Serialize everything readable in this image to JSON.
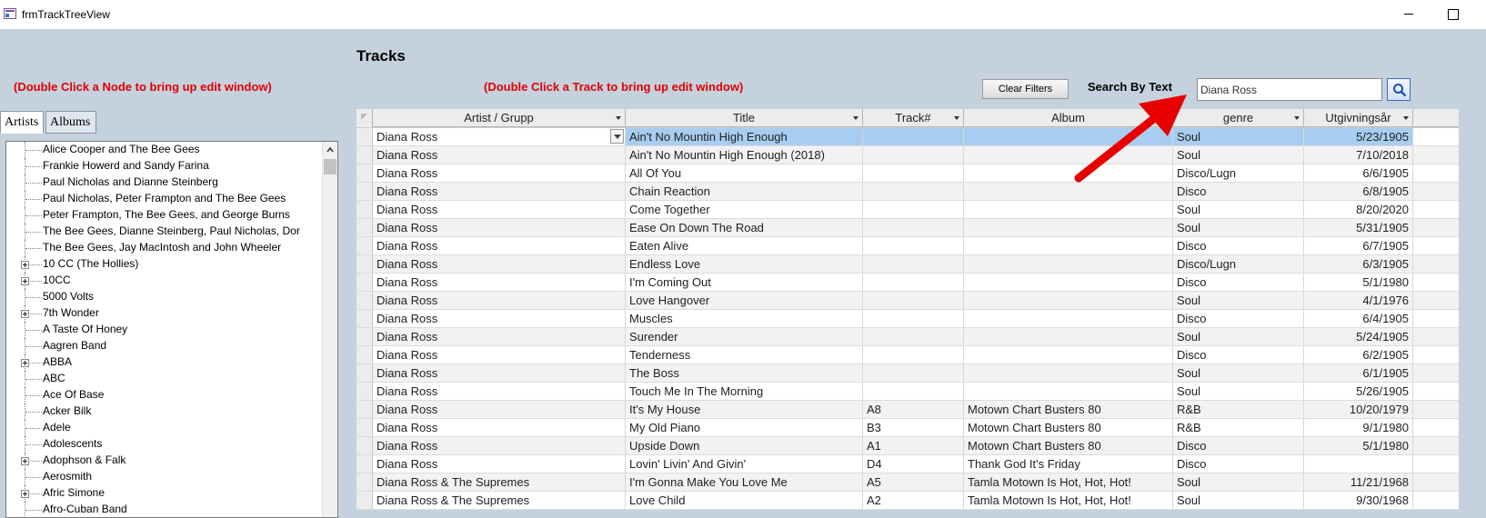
{
  "window": {
    "title": "frmTrackTreeView"
  },
  "form": {
    "heading": "Tracks",
    "tree_hint": "(Double Click a Node to bring up edit window)",
    "grid_hint": "(Double Click a Track to bring up edit window)",
    "clear_filters_label": "Clear Filters",
    "search_label": "Search By Text",
    "search_value": "Diana Ross"
  },
  "tabs": [
    {
      "label": "Artists"
    },
    {
      "label": "Albums"
    }
  ],
  "tree": {
    "items": [
      {
        "label": "Alice Cooper and The Bee Gees",
        "expandable": false
      },
      {
        "label": "Frankie Howerd and Sandy Farina",
        "expandable": false
      },
      {
        "label": "Paul Nicholas and Dianne Steinberg",
        "expandable": false
      },
      {
        "label": "Paul Nicholas, Peter Frampton and The Bee Gees",
        "expandable": false
      },
      {
        "label": "Peter Frampton, The Bee Gees, and George Burns",
        "expandable": false
      },
      {
        "label": "The Bee Gees, Dianne Steinberg, Paul Nicholas, Dor",
        "expandable": false
      },
      {
        "label": "The Bee Gees, Jay MacIntosh and John Wheeler",
        "expandable": false
      },
      {
        "label": "10 CC (The Hollies)",
        "expandable": true
      },
      {
        "label": "10CC",
        "expandable": true
      },
      {
        "label": "5000 Volts",
        "expandable": false
      },
      {
        "label": "7th Wonder",
        "expandable": true
      },
      {
        "label": "A Taste Of Honey",
        "expandable": false
      },
      {
        "label": "Aagren Band",
        "expandable": false
      },
      {
        "label": "ABBA",
        "expandable": true
      },
      {
        "label": "ABC",
        "expandable": false
      },
      {
        "label": "Ace Of Base",
        "expandable": false
      },
      {
        "label": "Acker Bilk",
        "expandable": false
      },
      {
        "label": "Adele",
        "expandable": false
      },
      {
        "label": "Adolescents",
        "expandable": false
      },
      {
        "label": "Adophson & Falk",
        "expandable": true
      },
      {
        "label": "Aerosmith",
        "expandable": false
      },
      {
        "label": "Afric Simone",
        "expandable": true
      },
      {
        "label": "Afro-Cuban Band",
        "expandable": false
      }
    ]
  },
  "grid": {
    "columns": [
      "Artist / Grupp",
      "Title",
      "Track#",
      "Album",
      "genre",
      "Utgivningsår"
    ],
    "rows": [
      [
        "Diana Ross",
        "Ain't No Mountin High Enough",
        "",
        "",
        "Soul",
        "5/23/1905"
      ],
      [
        "Diana Ross",
        "Ain't No Mountin High Enough (2018)",
        "",
        "",
        "Soul",
        "7/10/2018"
      ],
      [
        "Diana Ross",
        "All Of You",
        "",
        "",
        "Disco/Lugn",
        "6/6/1905"
      ],
      [
        "Diana Ross",
        "Chain Reaction",
        "",
        "",
        "Disco",
        "6/8/1905"
      ],
      [
        "Diana Ross",
        "Come Together",
        "",
        "",
        "Soul",
        "8/20/2020"
      ],
      [
        "Diana Ross",
        "Ease On Down The Road",
        "",
        "",
        "Soul",
        "5/31/1905"
      ],
      [
        "Diana Ross",
        "Eaten Alive",
        "",
        "",
        "Disco",
        "6/7/1905"
      ],
      [
        "Diana Ross",
        "Endless Love",
        "",
        "",
        "Disco/Lugn",
        "6/3/1905"
      ],
      [
        "Diana Ross",
        "I'm Coming Out",
        "",
        "",
        "Disco",
        "5/1/1980"
      ],
      [
        "Diana Ross",
        "Love Hangover",
        "",
        "",
        "Soul",
        "4/1/1976"
      ],
      [
        "Diana Ross",
        "Muscles",
        "",
        "",
        "Disco",
        "6/4/1905"
      ],
      [
        "Diana Ross",
        "Surender",
        "",
        "",
        "Soul",
        "5/24/1905"
      ],
      [
        "Diana Ross",
        "Tenderness",
        "",
        "",
        "Disco",
        "6/2/1905"
      ],
      [
        "Diana Ross",
        "The Boss",
        "",
        "",
        "Soul",
        "6/1/1905"
      ],
      [
        "Diana Ross",
        "Touch Me In The Morning",
        "",
        "",
        "Soul",
        "5/26/1905"
      ],
      [
        "Diana Ross",
        "It's My House",
        "A8",
        "Motown Chart Busters 80",
        "R&B",
        "10/20/1979"
      ],
      [
        "Diana Ross",
        "My Old Piano",
        "B3",
        "Motown Chart Busters 80",
        "R&B",
        "9/1/1980"
      ],
      [
        "Diana Ross",
        "Upside Down",
        "A1",
        "Motown Chart Busters 80",
        "Disco",
        "5/1/1980"
      ],
      [
        "Diana Ross",
        "Lovin' Livin' And Givin'",
        "D4",
        "Thank God It's Friday",
        "Disco",
        ""
      ],
      [
        "Diana Ross & The Supremes",
        "I'm Gonna Make You Love Me",
        "A5",
        "Tamla Motown Is Hot, Hot, Hot!",
        "Soul",
        "11/21/1968"
      ],
      [
        "Diana Ross & The Supremes",
        "Love Child",
        "A2",
        "Tamla Motown Is Hot, Hot, Hot!",
        "Soul",
        "9/30/1968"
      ]
    ]
  },
  "colors": {
    "form_background": "#c5d2de",
    "hint_text": "#e00000",
    "selection": "#a8cdf0",
    "annotation_arrow": "#e60000"
  }
}
